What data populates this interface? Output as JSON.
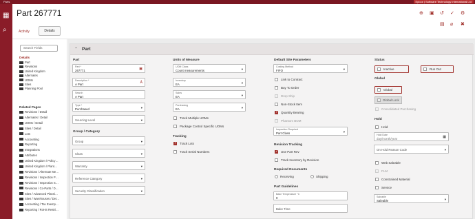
{
  "app": {
    "breadcrumb": "Parts",
    "env_tag": "Epicor | Software Technology International Ltd"
  },
  "header": {
    "title": "Part 267771",
    "tabs": {
      "activity": "Activity",
      "details": "Details"
    }
  },
  "icons": {
    "rail": [
      "grid-icon",
      "search-icon"
    ],
    "header_top": [
      "plus-circle-icon",
      "save-icon",
      "undo-icon",
      "check-icon",
      "settings-icon"
    ],
    "header_bottom": [
      "file-icon",
      "attachment-icon",
      "delete-icon"
    ]
  },
  "sidebar": {
    "search_placeholder": "Search Fields",
    "details_label": "Details",
    "details_items": [
      "Part",
      "Revisions",
      "United Kingdom",
      "Alternates",
      "UOMs",
      "Sites",
      "Planning Pool"
    ],
    "related_label": "Related Pages",
    "related_items": [
      "Revisions / Detail",
      "Alternates / Detail",
      "UOMs / Detail",
      "Sites / Detail",
      "Lots",
      "Accounting",
      "Reporting",
      "Integrations",
      "Attributes",
      "United Kingdom / Policy…",
      "United Kingdom / Plant…",
      "Revisions / Alternate Me…",
      "Revisions / Inspection P…",
      "Revisions / Inspection S…",
      "Revisions / Co-Parts / D…",
      "Sites / Advanced Planni…",
      "Sites / Warehouses / Det…",
      "Accounting / Tax Exemp…",
      "Reporting / RoHS Restri…"
    ]
  },
  "section": {
    "title": "Part"
  },
  "part_col": {
    "heading": "Part",
    "part_cap": "Part *",
    "part_val": "267771",
    "desc_cap": "Description *",
    "desc_val": "A Part",
    "search_cap": "Search",
    "search_val": "A Part",
    "type_cap": "Type *",
    "type_val": "Purchased",
    "sourcing_ph": "Sourcing Level",
    "group_heading": "Group / Category",
    "group_ph": "Group",
    "class_ph": "Class",
    "warranty_ph": "Warranty",
    "refcat_ph": "Reference Category",
    "security_ph": "Security Classification"
  },
  "uom_col": {
    "heading": "Units of Measure",
    "uomclass_cap": "UOM Class",
    "uomclass_val": "Count measurements",
    "inventory_cap": "Inventory",
    "inventory_val": "EA",
    "sales_cap": "Sales",
    "sales_val": "EA",
    "purchasing_cap": "Purchasing",
    "purchasing_val": "EA",
    "track_multiple": "Track Multiple UOMs",
    "package_control": "Package Control Specific UOMs",
    "tracking_heading": "Tracking",
    "track_lots": "Track Lots",
    "track_serial": "Track Serial Numbers"
  },
  "site_col": {
    "heading": "Default Site Parameters",
    "costing_cap": "Costing Method",
    "costing_val": "FIFO",
    "link_contract": "Link to Contract",
    "buy_to_order": "Buy To Order",
    "drop_ship": "Drop Ship",
    "non_stock": "Non-Stock Item",
    "qty_bearing": "Quantity Bearing",
    "phantom_bom": "Phantom BOM",
    "inspection_cap": "Inspection Required",
    "inspection_val": "Part Class",
    "rev_heading": "Revision Tracking",
    "use_part_rev": "Use Part Rev",
    "track_inv_rev": "Track Inventory by Revision",
    "req_docs_heading": "Required Documents",
    "receiving": "Receiving",
    "shipping": "Shipping",
    "guidelines_heading": "Part Guidelines",
    "bake_temp_cap": "Bake Temperature °C",
    "bake_temp_val": "0",
    "bake_time_ph": "Bake Time"
  },
  "status_col": {
    "heading": "Status",
    "inactive": "Inactive",
    "run_out": "Run Out",
    "global_heading": "Global",
    "global": "Global",
    "global_lock": "Global Lock",
    "consolidated": "Consolidated Purchasing",
    "hold_heading": "Hold",
    "hold": "Hold",
    "hold_date_cap": "Hold Date",
    "hold_date_ph": "day/month/year",
    "hold_reason_ph": "On Hold Reason Code",
    "web_saleable": "Web Saleable",
    "flm": "FLM",
    "constrained": "Constrained Material",
    "service": "Service",
    "saleable_cap": "Saleable",
    "saleable_val": "Saleable"
  },
  "colors": {
    "brand": "#8a1c28",
    "accent": "#a1312c"
  }
}
